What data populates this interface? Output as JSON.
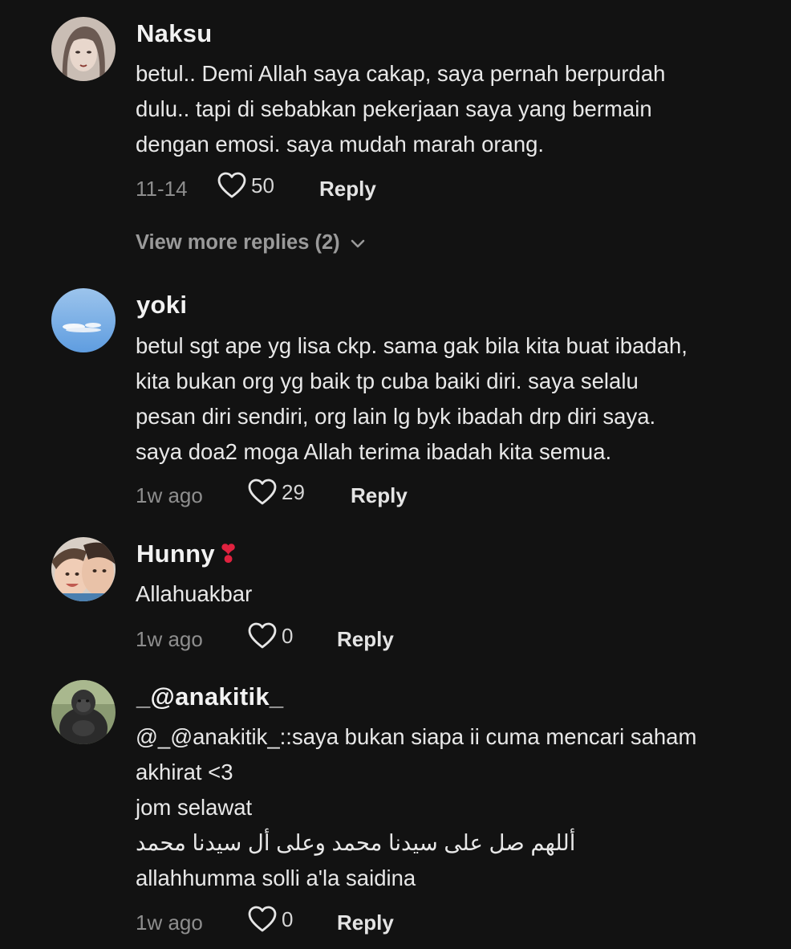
{
  "comments": [
    {
      "username": "Naksu",
      "username_emoji": "",
      "lines": [
        "betul.. Demi Allah saya cakap, saya pernah berpurdah",
        "dulu.. tapi di sebabkan pekerjaan saya yang bermain",
        "dengan emosi. saya mudah marah orang."
      ],
      "date": "11-14",
      "likes": "50",
      "reply_label": "Reply",
      "view_more": "View more replies (2)"
    },
    {
      "username": "yoki",
      "username_emoji": "",
      "lines": [
        "betul sgt ape yg lisa ckp. sama gak bila kita buat ibadah,",
        "kita bukan org yg baik tp cuba baiki diri. saya selalu",
        "pesan diri sendiri, org lain lg byk ibadah drp diri saya.",
        "saya doa2 moga Allah terima ibadah kita semua."
      ],
      "date": "1w ago",
      "likes": "29",
      "reply_label": "Reply"
    },
    {
      "username": "Hunny",
      "username_emoji": "❣",
      "lines": [
        "Allahuakbar"
      ],
      "date": "1w ago",
      "likes": "0",
      "reply_label": "Reply"
    },
    {
      "username": "_@anakitik_",
      "username_emoji": "",
      "lines": [
        "@_@anakitik_::saya bukan siapa ii cuma mencari saham",
        "akhirat <3",
        "jom selawat",
        "أللهم صل على سيدنا محمد وعلى أل سيدنا محمد",
        "allahhumma solli a'la saidina"
      ],
      "date": "1w ago",
      "likes": "0",
      "reply_label": "Reply"
    }
  ],
  "icons": {
    "like": "heart-outline-icon",
    "expand": "chevron-down-icon"
  },
  "colors": {
    "background": "#121212",
    "text": "#e8e8e8",
    "muted": "#8e8e8e",
    "emoji": "#e0223f"
  }
}
